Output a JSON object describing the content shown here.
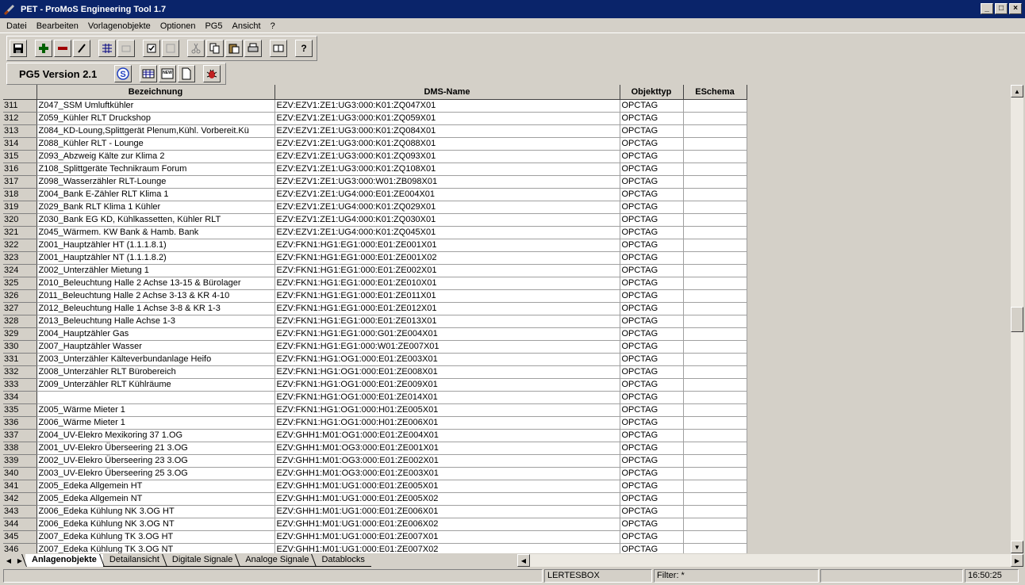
{
  "window": {
    "title": "PET - ProMoS Engineering Tool  1.7"
  },
  "menu": [
    "Datei",
    "Bearbeiten",
    "Vorlagenobjekte",
    "Optionen",
    "PG5",
    "Ansicht",
    "?"
  ],
  "pg5_label": "PG5 Version 2.1",
  "toolbar2_new_icon_text": "NEW",
  "columns": [
    "Bezeichnung",
    "DMS-Name",
    "Objekttyp",
    "ESchema"
  ],
  "rows": [
    {
      "n": "311",
      "bez": "Z047_SSM Umluftkühler",
      "dms": "EZV:EZV1:ZE1:UG3:000:K01:ZQ047X01",
      "typ": "OPCTAG",
      "esch": ""
    },
    {
      "n": "312",
      "bez": "Z059_Kühler RLT Druckshop",
      "dms": "EZV:EZV1:ZE1:UG3:000:K01:ZQ059X01",
      "typ": "OPCTAG",
      "esch": ""
    },
    {
      "n": "313",
      "bez": "Z084_KD-Loung,Splittgerät Plenum,Kühl. Vorbereit.Kü",
      "dms": "EZV:EZV1:ZE1:UG3:000:K01:ZQ084X01",
      "typ": "OPCTAG",
      "esch": ""
    },
    {
      "n": "314",
      "bez": "Z088_Kühler RLT - Lounge",
      "dms": "EZV:EZV1:ZE1:UG3:000:K01:ZQ088X01",
      "typ": "OPCTAG",
      "esch": ""
    },
    {
      "n": "315",
      "bez": "Z093_Abzweig Kälte zur Klima 2",
      "dms": "EZV:EZV1:ZE1:UG3:000:K01:ZQ093X01",
      "typ": "OPCTAG",
      "esch": ""
    },
    {
      "n": "316",
      "bez": "Z108_Splittgeräte Technikraum Forum",
      "dms": "EZV:EZV1:ZE1:UG3:000:K01:ZQ108X01",
      "typ": "OPCTAG",
      "esch": ""
    },
    {
      "n": "317",
      "bez": "Z098_Wasserzähler RLT-Lounge",
      "dms": "EZV:EZV1:ZE1:UG3:000:W01:ZB098X01",
      "typ": "OPCTAG",
      "esch": ""
    },
    {
      "n": "318",
      "bez": "Z004_Bank E-Zähler RLT  Klima 1",
      "dms": "EZV:EZV1:ZE1:UG4:000:E01:ZE004X01",
      "typ": "OPCTAG",
      "esch": ""
    },
    {
      "n": "319",
      "bez": "Z029_Bank RLT Klima 1 Kühler",
      "dms": "EZV:EZV1:ZE1:UG4:000:K01:ZQ029X01",
      "typ": "OPCTAG",
      "esch": ""
    },
    {
      "n": "320",
      "bez": "Z030_Bank EG KD, Kühlkassetten, Kühler RLT",
      "dms": "EZV:EZV1:ZE1:UG4:000:K01:ZQ030X01",
      "typ": "OPCTAG",
      "esch": ""
    },
    {
      "n": "321",
      "bez": "Z045_Wärmem. KW Bank & Hamb. Bank",
      "dms": "EZV:EZV1:ZE1:UG4:000:K01:ZQ045X01",
      "typ": "OPCTAG",
      "esch": ""
    },
    {
      "n": "322",
      "bez": "Z001_Hauptzähler HT (1.1.1.8.1)",
      "dms": "EZV:FKN1:HG1:EG1:000:E01:ZE001X01",
      "typ": "OPCTAG",
      "esch": ""
    },
    {
      "n": "323",
      "bez": "Z001_Hauptzähler NT (1.1.1.8.2)",
      "dms": "EZV:FKN1:HG1:EG1:000:E01:ZE001X02",
      "typ": "OPCTAG",
      "esch": ""
    },
    {
      "n": "324",
      "bez": "Z002_Unterzähler Mietung 1",
      "dms": "EZV:FKN1:HG1:EG1:000:E01:ZE002X01",
      "typ": "OPCTAG",
      "esch": ""
    },
    {
      "n": "325",
      "bez": "Z010_Beleuchtung Halle 2 Achse 13-15 & Bürolager",
      "dms": "EZV:FKN1:HG1:EG1:000:E01:ZE010X01",
      "typ": "OPCTAG",
      "esch": ""
    },
    {
      "n": "326",
      "bez": "Z011_Beleuchtung Halle 2 Achse 3-13 & KR 4-10",
      "dms": "EZV:FKN1:HG1:EG1:000:E01:ZE011X01",
      "typ": "OPCTAG",
      "esch": ""
    },
    {
      "n": "327",
      "bez": "Z012_Beleuchtung Halle 1 Achse 3-8 & KR 1-3",
      "dms": "EZV:FKN1:HG1:EG1:000:E01:ZE012X01",
      "typ": "OPCTAG",
      "esch": ""
    },
    {
      "n": "328",
      "bez": "Z013_Beleuchtung Halle Achse 1-3",
      "dms": "EZV:FKN1:HG1:EG1:000:E01:ZE013X01",
      "typ": "OPCTAG",
      "esch": ""
    },
    {
      "n": "329",
      "bez": "Z004_Hauptzähler Gas",
      "dms": "EZV:FKN1:HG1:EG1:000:G01:ZE004X01",
      "typ": "OPCTAG",
      "esch": ""
    },
    {
      "n": "330",
      "bez": "Z007_Hauptzähler Wasser",
      "dms": "EZV:FKN1:HG1:EG1:000:W01:ZE007X01",
      "typ": "OPCTAG",
      "esch": ""
    },
    {
      "n": "331",
      "bez": "Z003_Unterzähler Kälteverbundanlage Heifo",
      "dms": "EZV:FKN1:HG1:OG1:000:E01:ZE003X01",
      "typ": "OPCTAG",
      "esch": ""
    },
    {
      "n": "332",
      "bez": "Z008_Unterzähler RLT Bürobereich",
      "dms": "EZV:FKN1:HG1:OG1:000:E01:ZE008X01",
      "typ": "OPCTAG",
      "esch": ""
    },
    {
      "n": "333",
      "bez": "Z009_Unterzähler RLT Kühlräume",
      "dms": "EZV:FKN1:HG1:OG1:000:E01:ZE009X01",
      "typ": "OPCTAG",
      "esch": ""
    },
    {
      "n": "334",
      "bez": "",
      "dms": "EZV:FKN1:HG1:OG1:000:E01:ZE014X01",
      "typ": "OPCTAG",
      "esch": ""
    },
    {
      "n": "335",
      "bez": "Z005_Wärme Mieter 1",
      "dms": "EZV:FKN1:HG1:OG1:000:H01:ZE005X01",
      "typ": "OPCTAG",
      "esch": ""
    },
    {
      "n": "336",
      "bez": "Z006_Wärme Mieter 1",
      "dms": "EZV:FKN1:HG1:OG1:000:H01:ZE006X01",
      "typ": "OPCTAG",
      "esch": ""
    },
    {
      "n": "337",
      "bez": "Z004_UV-Elekro Mexikoring 37 1.OG",
      "dms": "EZV:GHH1:M01:OG1:000:E01:ZE004X01",
      "typ": "OPCTAG",
      "esch": ""
    },
    {
      "n": "338",
      "bez": "Z001_UV-Elekro Überseering 21 3.OG",
      "dms": "EZV:GHH1:M01:OG3:000:E01:ZE001X01",
      "typ": "OPCTAG",
      "esch": ""
    },
    {
      "n": "339",
      "bez": "Z002_UV-Elekro Überseering 23 3.OG",
      "dms": "EZV:GHH1:M01:OG3:000:E01:ZE002X01",
      "typ": "OPCTAG",
      "esch": ""
    },
    {
      "n": "340",
      "bez": "Z003_UV-Elekro Überseering 25 3.OG",
      "dms": "EZV:GHH1:M01:OG3:000:E01:ZE003X01",
      "typ": "OPCTAG",
      "esch": ""
    },
    {
      "n": "341",
      "bez": "Z005_Edeka Allgemein HT",
      "dms": "EZV:GHH1:M01:UG1:000:E01:ZE005X01",
      "typ": "OPCTAG",
      "esch": ""
    },
    {
      "n": "342",
      "bez": "Z005_Edeka Allgemein NT",
      "dms": "EZV:GHH1:M01:UG1:000:E01:ZE005X02",
      "typ": "OPCTAG",
      "esch": ""
    },
    {
      "n": "343",
      "bez": "Z006_Edeka Kühlung NK 3.OG HT",
      "dms": "EZV:GHH1:M01:UG1:000:E01:ZE006X01",
      "typ": "OPCTAG",
      "esch": ""
    },
    {
      "n": "344",
      "bez": "Z006_Edeka Kühlung NK 3.OG NT",
      "dms": "EZV:GHH1:M01:UG1:000:E01:ZE006X02",
      "typ": "OPCTAG",
      "esch": ""
    },
    {
      "n": "345",
      "bez": "Z007_Edeka Kühlung TK 3.OG HT",
      "dms": "EZV:GHH1:M01:UG1:000:E01:ZE007X01",
      "typ": "OPCTAG",
      "esch": ""
    },
    {
      "n": "346",
      "bez": "Z007_Edeka Kühlung TK 3.OG NT",
      "dms": "EZV:GHH1:M01:UG1:000:E01:ZE007X02",
      "typ": "OPCTAG",
      "esch": ""
    }
  ],
  "tabs": [
    "Anlagenobjekte",
    "Detailansicht",
    "Digitale Signale",
    "Analoge Signale",
    "Datablocks"
  ],
  "active_tab": 0,
  "status": {
    "panel1": "",
    "panel2": "LERTESBOX",
    "filter": "Filter: *",
    "panel4": "",
    "time": "16:50:25"
  },
  "scroll_position": 0.5
}
